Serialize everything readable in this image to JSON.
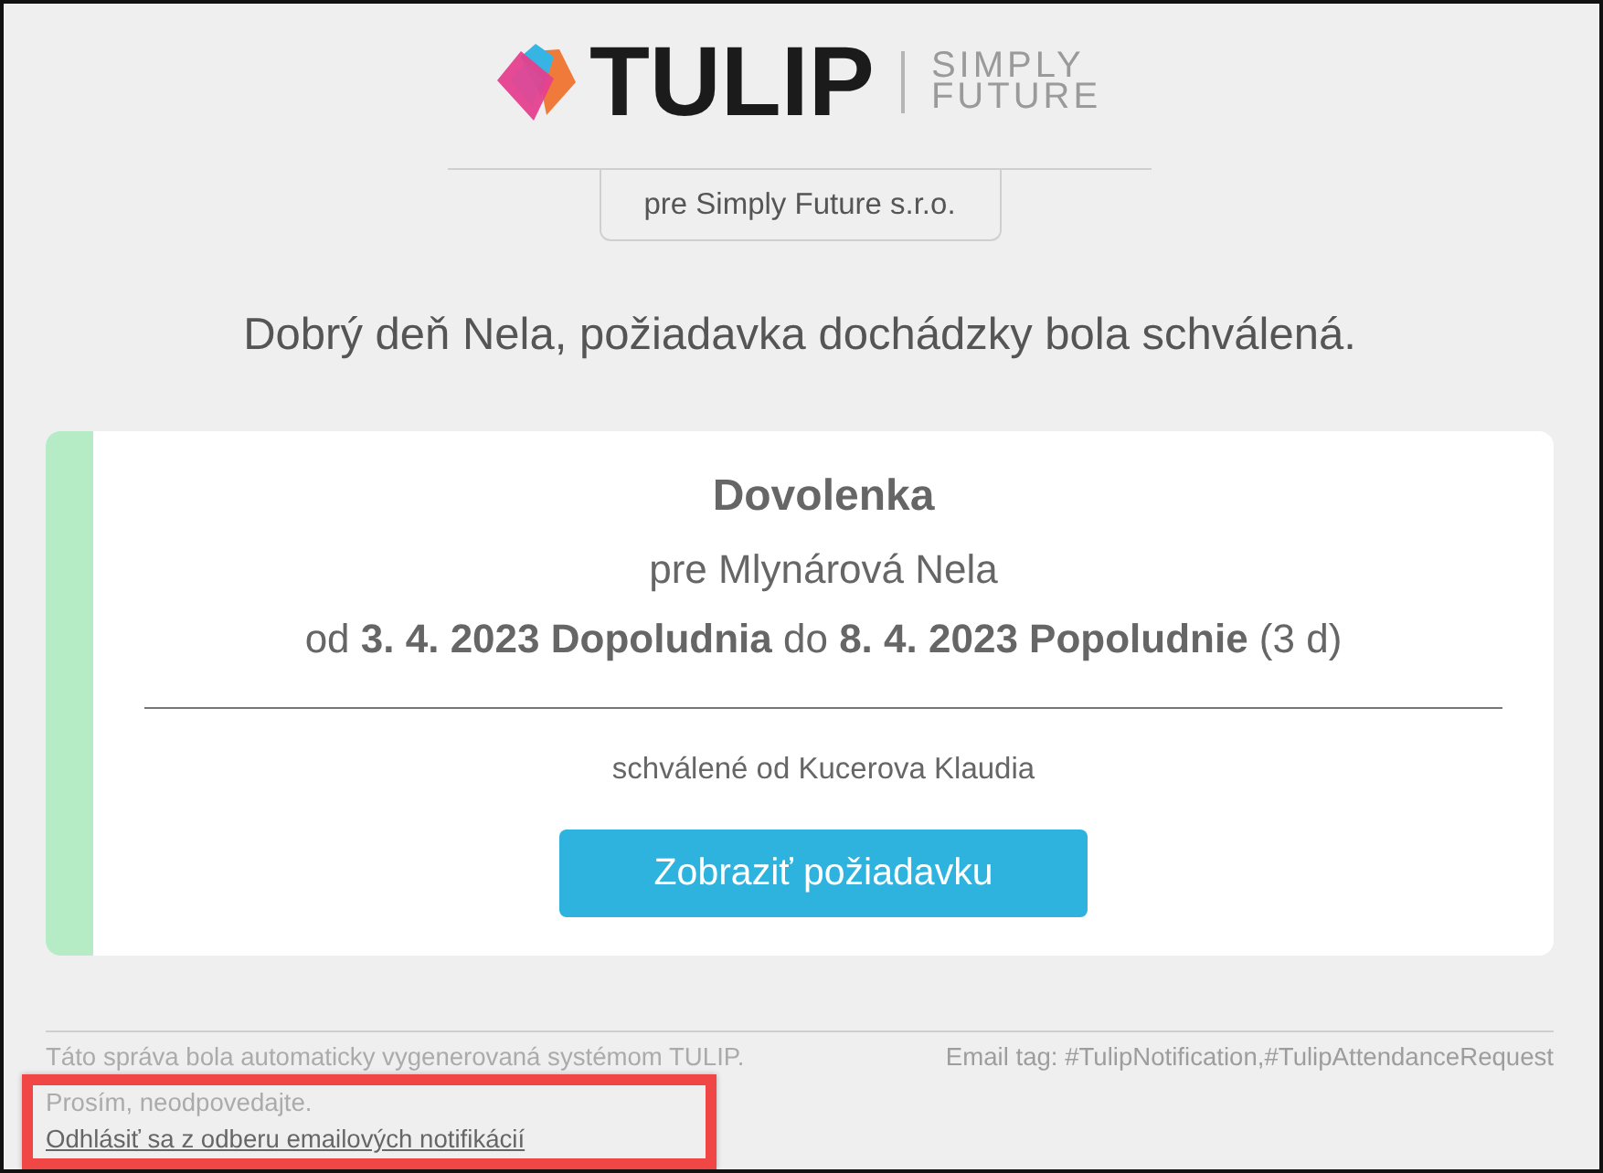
{
  "logo": {
    "wordmark": "TULIP",
    "tagline": [
      "SIMPLY",
      "FUTURE"
    ]
  },
  "company_tab": "pre Simply Future s.r.o.",
  "greeting": "Dobrý deň Nela, požiadavka dochádzky bola schválená.",
  "request": {
    "type": "Dovolenka",
    "employee": "pre Mlynárová Nela",
    "period": "od **3. 4. 2023 Dopoludnia** do **8. 4. 2023 Popoludnie** (3 d)",
    "approved_by": "schválené od Kucerova Klaudia",
    "button": "Zobraziť požiadavku"
  },
  "footer": {
    "notice": "Táto správa bola automaticky vygenerovaná systémom TULIP.",
    "email_tag": "Email tag: #TulipNotification,#TulipAttendanceRequest",
    "reply_note": "Prosím, neodpovedajte.",
    "unsubscribe_link": "Odhlásiť sa z odberu emailových notifikácií"
  }
}
